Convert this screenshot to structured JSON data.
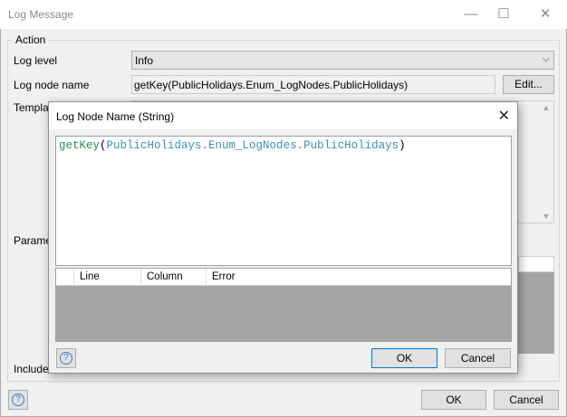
{
  "window": {
    "title": "Log Message",
    "minimize": "—",
    "maximize": "☐",
    "close": "✕"
  },
  "group": {
    "label": "Action"
  },
  "labels": {
    "log_level": "Log level",
    "log_node_name": "Log node name",
    "template": "Templat",
    "parameters": "Parame",
    "include": "Include"
  },
  "log_level": {
    "value": "Info"
  },
  "log_node": {
    "value": "getKey(PublicHolidays.Enum_LogNodes.PublicHolidays)",
    "edit_label": "Edit..."
  },
  "footer": {
    "ok": "OK",
    "cancel": "Cancel",
    "help": "?"
  },
  "dialog": {
    "title": "Log Node Name (String)",
    "close": "✕",
    "code_fn": "getKey",
    "code_open": "(",
    "code_arg": "PublicHolidays.Enum_LogNodes.PublicHolidays",
    "code_close": ")",
    "columns": [
      "Line",
      "Column",
      "Error"
    ],
    "ok": "OK",
    "cancel": "Cancel",
    "help": "?"
  }
}
